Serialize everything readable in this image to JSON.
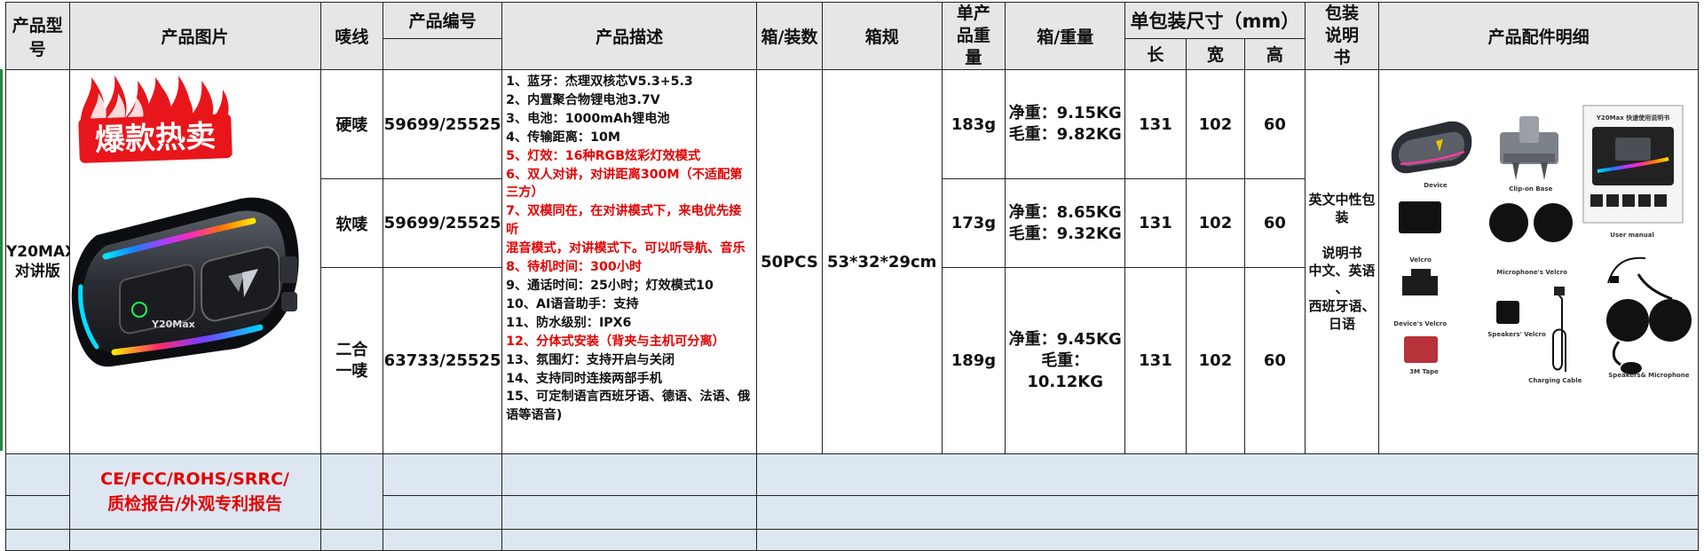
{
  "headers": {
    "model": "产品型号",
    "image": "产品图片",
    "shell": "唛线",
    "code": "产品编号",
    "desc": "产品描述",
    "qty": "箱/装数",
    "carton": "箱规",
    "unit_weight": "单产品重量",
    "box_weight": "箱/重量",
    "pack_size": "单包装尺寸（mm）",
    "length": "长",
    "width": "宽",
    "height": "高",
    "manual": "包装说明书",
    "accessories": "产品配件明细"
  },
  "product": {
    "model_line1": "Y20MAX",
    "model_line2": "对讲版",
    "hot_label": "爆款热卖",
    "device_brand": "Y20Max",
    "qty": "50PCS",
    "carton": "53*32*29cm",
    "manual_lines": [
      "英文中性包装",
      "",
      "说明书",
      "中文、英语",
      "、",
      "西班牙语、",
      "日语"
    ]
  },
  "variants": [
    {
      "shell": "硬唛",
      "code": "59699/25525",
      "unit_weight": "183g",
      "net": "净重：9.15KG",
      "gross": "毛重：9.82KG",
      "l": "131",
      "w": "102",
      "h": "60"
    },
    {
      "shell": "软唛",
      "code": "59699/25525",
      "unit_weight": "173g",
      "net": "净重：8.65KG",
      "gross": "毛重：9.32KG",
      "l": "131",
      "w": "102",
      "h": "60"
    },
    {
      "shell": "二合一唛",
      "code": "63733/25525",
      "unit_weight": "189g",
      "net": "净重：9.45KG",
      "gross": "毛重：10.12KG",
      "l": "131",
      "w": "102",
      "h": "60"
    }
  ],
  "description": [
    {
      "text": "1、蓝牙：杰理双核芯V5.3+5.3",
      "red": false
    },
    {
      "text": "2、内置聚合物锂电池3.7V",
      "red": false
    },
    {
      "text": "3、电池：1000mAh锂电池",
      "red": false
    },
    {
      "text": "4、传输距离：10M",
      "red": false
    },
    {
      "text": "5、灯效：16种RGB炫彩灯效模式",
      "red": true
    },
    {
      "text": "6、双人对讲，对讲距离300M（不适配第三方）",
      "red": true
    },
    {
      "text": "7、双模同在，在对讲模式下，来电优先接听",
      "red": true
    },
    {
      "text": "   混音模式，对讲模式下。可以听导航、音乐",
      "red": true
    },
    {
      "text": "8、待机时间：300小时",
      "red": true
    },
    {
      "text": "9、通话时间：25小时；灯效模式10",
      "red": false
    },
    {
      "text": "10、AI语音助手：支持",
      "red": false
    },
    {
      "text": "11、防水级别：IPX6",
      "red": false
    },
    {
      "text": "12、分体式安装（背夹与主机可分离）",
      "red": true
    },
    {
      "text": "13、氛围灯：支持开启与关闭",
      "red": false
    },
    {
      "text": "14、支持同时连接两部手机",
      "red": false
    },
    {
      "text": "15、可定制语言西班牙语、德语、法语、俄语等语音)",
      "red": false
    }
  ],
  "certs": {
    "line1": "CE/FCC/ROHS/SRRC/",
    "line2": "质检报告/外观专利报告"
  },
  "accessory_labels": {
    "device": "Device",
    "clip": "Clip-on Base",
    "manual": "User manual",
    "velcro": "Velcro",
    "mic_velcro": "Microphone's Velcro",
    "device_velcro": "Device's Velcro",
    "speaker_velcro": "Speakers' Velcro",
    "tape": "3M Tape",
    "cable": "Charging Cable",
    "speakers": "Speakers& Microphone",
    "manual_title": "Y20Max 快速使用说明书"
  },
  "colors": {
    "header_bg": "#e6e6e6",
    "band_bg": "#dde7f1",
    "accent_red": "#e60000",
    "flame_red": "#e8161b"
  }
}
